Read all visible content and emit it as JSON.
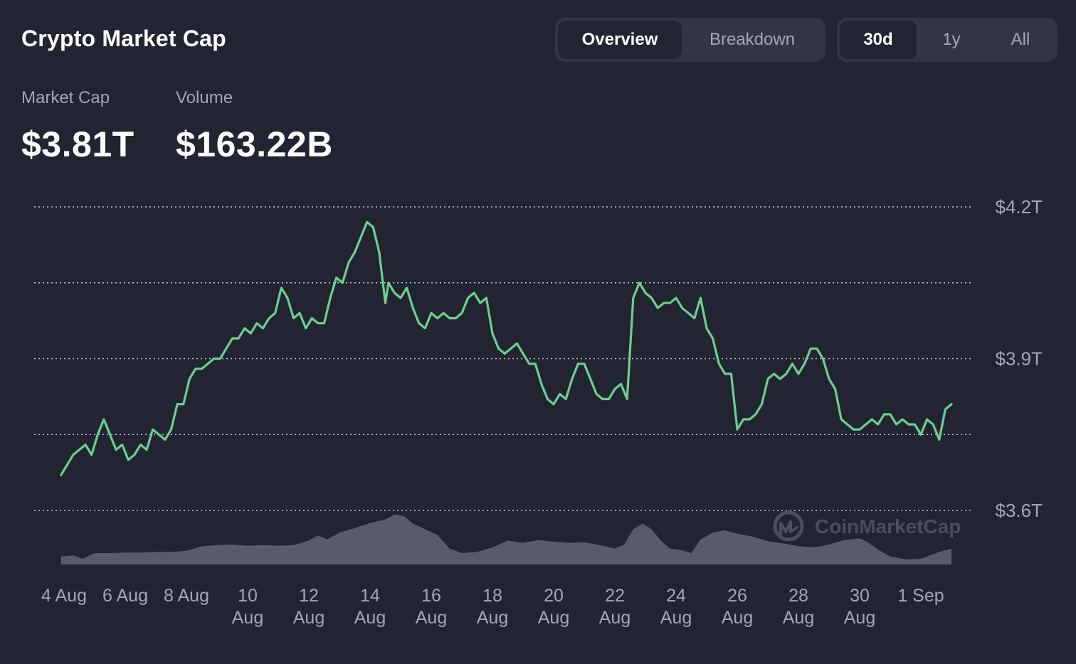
{
  "header": {
    "title": "Crypto Market Cap",
    "view_tabs": [
      {
        "label": "Overview",
        "active": true
      },
      {
        "label": "Breakdown",
        "active": false
      }
    ],
    "range_tabs": [
      {
        "label": "30d",
        "active": true
      },
      {
        "label": "1y",
        "active": false
      },
      {
        "label": "All",
        "active": false
      }
    ]
  },
  "stats": {
    "market_cap": {
      "label": "Market Cap",
      "value": "$3.81T"
    },
    "volume": {
      "label": "Volume",
      "value": "$163.22B"
    }
  },
  "watermark": "CoinMarketCap",
  "colors": {
    "background": "#222531",
    "line": "#6ccf8e",
    "volume": "#585b6a",
    "grid": "#c8ccd8",
    "muted_text": "#a1a7bb"
  },
  "chart_data": {
    "type": "line",
    "title": "",
    "xlabel": "",
    "ylabel": "",
    "y_axis_side": "right",
    "ylim": [
      3.6,
      4.2
    ],
    "y_ticks": [
      {
        "value": 4.2,
        "label": "$4.2T"
      },
      {
        "value": 3.9,
        "label": "$3.9T"
      },
      {
        "value": 3.6,
        "label": "$3.6T"
      }
    ],
    "gridlines": [
      3.6,
      3.75,
      3.9,
      4.05,
      4.2
    ],
    "grid": true,
    "x_ticks": [
      {
        "day": 0,
        "label": [
          "4 Aug"
        ]
      },
      {
        "day": 2,
        "label": [
          "6 Aug"
        ]
      },
      {
        "day": 4,
        "label": [
          "8 Aug"
        ]
      },
      {
        "day": 6,
        "label": [
          "10",
          "Aug"
        ]
      },
      {
        "day": 8,
        "label": [
          "12",
          "Aug"
        ]
      },
      {
        "day": 10,
        "label": [
          "14",
          "Aug"
        ]
      },
      {
        "day": 12,
        "label": [
          "16",
          "Aug"
        ]
      },
      {
        "day": 14,
        "label": [
          "18",
          "Aug"
        ]
      },
      {
        "day": 16,
        "label": [
          "20",
          "Aug"
        ]
      },
      {
        "day": 18,
        "label": [
          "22",
          "Aug"
        ]
      },
      {
        "day": 20,
        "label": [
          "24",
          "Aug"
        ]
      },
      {
        "day": 22,
        "label": [
          "26",
          "Aug"
        ]
      },
      {
        "day": 24,
        "label": [
          "28",
          "Aug"
        ]
      },
      {
        "day": 26,
        "label": [
          "30",
          "Aug"
        ]
      },
      {
        "day": 28,
        "label": [
          "1 Sep"
        ]
      }
    ],
    "series": [
      {
        "type": "line",
        "unit": "trillion USD",
        "points": [
          [
            -0.1,
            3.67
          ],
          [
            0.1,
            3.69
          ],
          [
            0.3,
            3.71
          ],
          [
            0.5,
            3.72
          ],
          [
            0.7,
            3.73
          ],
          [
            0.9,
            3.71
          ],
          [
            1.1,
            3.75
          ],
          [
            1.3,
            3.78
          ],
          [
            1.5,
            3.75
          ],
          [
            1.7,
            3.72
          ],
          [
            1.9,
            3.73
          ],
          [
            2.1,
            3.7
          ],
          [
            2.3,
            3.71
          ],
          [
            2.5,
            3.73
          ],
          [
            2.7,
            3.72
          ],
          [
            2.9,
            3.76
          ],
          [
            3.1,
            3.75
          ],
          [
            3.3,
            3.74
          ],
          [
            3.5,
            3.76
          ],
          [
            3.7,
            3.81
          ],
          [
            3.9,
            3.81
          ],
          [
            4.1,
            3.86
          ],
          [
            4.3,
            3.88
          ],
          [
            4.5,
            3.88
          ],
          [
            4.7,
            3.89
          ],
          [
            4.9,
            3.9
          ],
          [
            5.1,
            3.9
          ],
          [
            5.3,
            3.92
          ],
          [
            5.5,
            3.94
          ],
          [
            5.7,
            3.94
          ],
          [
            5.9,
            3.96
          ],
          [
            6.1,
            3.95
          ],
          [
            6.3,
            3.97
          ],
          [
            6.5,
            3.96
          ],
          [
            6.7,
            3.98
          ],
          [
            6.9,
            3.99
          ],
          [
            7.1,
            4.04
          ],
          [
            7.3,
            4.02
          ],
          [
            7.5,
            3.98
          ],
          [
            7.7,
            3.99
          ],
          [
            7.9,
            3.96
          ],
          [
            8.1,
            3.98
          ],
          [
            8.3,
            3.97
          ],
          [
            8.5,
            3.97
          ],
          [
            8.7,
            4.02
          ],
          [
            8.9,
            4.06
          ],
          [
            9.1,
            4.05
          ],
          [
            9.3,
            4.09
          ],
          [
            9.5,
            4.11
          ],
          [
            9.7,
            4.14
          ],
          [
            9.9,
            4.17
          ],
          [
            10.1,
            4.16
          ],
          [
            10.3,
            4.11
          ],
          [
            10.5,
            4.01
          ],
          [
            10.6,
            4.05
          ],
          [
            10.8,
            4.03
          ],
          [
            11.0,
            4.02
          ],
          [
            11.2,
            4.04
          ],
          [
            11.4,
            4.0
          ],
          [
            11.6,
            3.97
          ],
          [
            11.8,
            3.96
          ],
          [
            12.0,
            3.99
          ],
          [
            12.2,
            3.98
          ],
          [
            12.4,
            3.99
          ],
          [
            12.6,
            3.98
          ],
          [
            12.8,
            3.98
          ],
          [
            13.0,
            3.99
          ],
          [
            13.2,
            4.02
          ],
          [
            13.4,
            4.03
          ],
          [
            13.6,
            4.01
          ],
          [
            13.8,
            4.02
          ],
          [
            14.0,
            3.95
          ],
          [
            14.2,
            3.92
          ],
          [
            14.4,
            3.91
          ],
          [
            14.6,
            3.92
          ],
          [
            14.8,
            3.93
          ],
          [
            15.0,
            3.91
          ],
          [
            15.2,
            3.89
          ],
          [
            15.4,
            3.89
          ],
          [
            15.6,
            3.85
          ],
          [
            15.8,
            3.82
          ],
          [
            16.0,
            3.81
          ],
          [
            16.2,
            3.83
          ],
          [
            16.4,
            3.82
          ],
          [
            16.6,
            3.86
          ],
          [
            16.8,
            3.89
          ],
          [
            17.0,
            3.89
          ],
          [
            17.2,
            3.86
          ],
          [
            17.4,
            3.83
          ],
          [
            17.6,
            3.82
          ],
          [
            17.8,
            3.82
          ],
          [
            18.0,
            3.84
          ],
          [
            18.2,
            3.85
          ],
          [
            18.4,
            3.82
          ],
          [
            18.6,
            4.02
          ],
          [
            18.8,
            4.05
          ],
          [
            19.0,
            4.03
          ],
          [
            19.2,
            4.02
          ],
          [
            19.4,
            4.0
          ],
          [
            19.6,
            4.01
          ],
          [
            19.8,
            4.01
          ],
          [
            20.0,
            4.02
          ],
          [
            20.2,
            4.0
          ],
          [
            20.4,
            3.99
          ],
          [
            20.6,
            3.98
          ],
          [
            20.8,
            4.02
          ],
          [
            21.0,
            3.96
          ],
          [
            21.2,
            3.94
          ],
          [
            21.4,
            3.89
          ],
          [
            21.6,
            3.87
          ],
          [
            21.8,
            3.87
          ],
          [
            22.0,
            3.76
          ],
          [
            22.2,
            3.78
          ],
          [
            22.4,
            3.78
          ],
          [
            22.6,
            3.79
          ],
          [
            22.8,
            3.81
          ],
          [
            23.0,
            3.86
          ],
          [
            23.2,
            3.87
          ],
          [
            23.4,
            3.86
          ],
          [
            23.6,
            3.87
          ],
          [
            23.8,
            3.89
          ],
          [
            24.0,
            3.87
          ],
          [
            24.2,
            3.89
          ],
          [
            24.4,
            3.92
          ],
          [
            24.6,
            3.92
          ],
          [
            24.8,
            3.9
          ],
          [
            25.0,
            3.86
          ],
          [
            25.2,
            3.84
          ],
          [
            25.4,
            3.78
          ],
          [
            25.6,
            3.77
          ],
          [
            25.8,
            3.76
          ],
          [
            26.0,
            3.76
          ],
          [
            26.2,
            3.77
          ],
          [
            26.4,
            3.78
          ],
          [
            26.6,
            3.77
          ],
          [
            26.8,
            3.79
          ],
          [
            27.0,
            3.79
          ],
          [
            27.2,
            3.77
          ],
          [
            27.4,
            3.78
          ],
          [
            27.6,
            3.77
          ],
          [
            27.8,
            3.77
          ],
          [
            28.0,
            3.75
          ],
          [
            28.2,
            3.78
          ],
          [
            28.4,
            3.77
          ],
          [
            28.6,
            3.74
          ],
          [
            28.8,
            3.8
          ],
          [
            29.0,
            3.81
          ]
        ]
      },
      {
        "type": "area",
        "name": "",
        "relative_height_0_1": [
          [
            -0.1,
            0.14
          ],
          [
            0.3,
            0.16
          ],
          [
            0.6,
            0.1
          ],
          [
            1.0,
            0.2
          ],
          [
            1.5,
            0.2
          ],
          [
            2.0,
            0.21
          ],
          [
            2.5,
            0.21
          ],
          [
            3.0,
            0.22
          ],
          [
            3.5,
            0.22
          ],
          [
            4.0,
            0.24
          ],
          [
            4.5,
            0.32
          ],
          [
            5.0,
            0.34
          ],
          [
            5.5,
            0.35
          ],
          [
            6.0,
            0.33
          ],
          [
            6.5,
            0.34
          ],
          [
            7.0,
            0.33
          ],
          [
            7.5,
            0.34
          ],
          [
            8.0,
            0.42
          ],
          [
            8.3,
            0.51
          ],
          [
            8.6,
            0.44
          ],
          [
            9.0,
            0.56
          ],
          [
            9.5,
            0.64
          ],
          [
            10.0,
            0.73
          ],
          [
            10.5,
            0.79
          ],
          [
            10.8,
            0.88
          ],
          [
            11.1,
            0.85
          ],
          [
            11.4,
            0.72
          ],
          [
            11.8,
            0.62
          ],
          [
            12.2,
            0.52
          ],
          [
            12.6,
            0.28
          ],
          [
            13.0,
            0.2
          ],
          [
            13.5,
            0.22
          ],
          [
            14.0,
            0.3
          ],
          [
            14.5,
            0.42
          ],
          [
            15.0,
            0.38
          ],
          [
            15.5,
            0.43
          ],
          [
            16.0,
            0.4
          ],
          [
            16.5,
            0.38
          ],
          [
            17.0,
            0.39
          ],
          [
            17.5,
            0.34
          ],
          [
            18.0,
            0.28
          ],
          [
            18.3,
            0.35
          ],
          [
            18.6,
            0.62
          ],
          [
            18.9,
            0.72
          ],
          [
            19.2,
            0.62
          ],
          [
            19.5,
            0.42
          ],
          [
            19.8,
            0.28
          ],
          [
            20.2,
            0.25
          ],
          [
            20.5,
            0.2
          ],
          [
            20.8,
            0.44
          ],
          [
            21.2,
            0.56
          ],
          [
            21.6,
            0.6
          ],
          [
            22.0,
            0.54
          ],
          [
            22.5,
            0.49
          ],
          [
            23.0,
            0.41
          ],
          [
            23.5,
            0.37
          ],
          [
            24.0,
            0.32
          ],
          [
            24.5,
            0.3
          ],
          [
            25.0,
            0.35
          ],
          [
            25.5,
            0.43
          ],
          [
            26.0,
            0.46
          ],
          [
            26.3,
            0.38
          ],
          [
            26.6,
            0.26
          ],
          [
            27.0,
            0.14
          ],
          [
            27.5,
            0.09
          ],
          [
            28.0,
            0.1
          ],
          [
            28.3,
            0.16
          ],
          [
            28.6,
            0.22
          ],
          [
            29.0,
            0.28
          ]
        ]
      }
    ]
  }
}
